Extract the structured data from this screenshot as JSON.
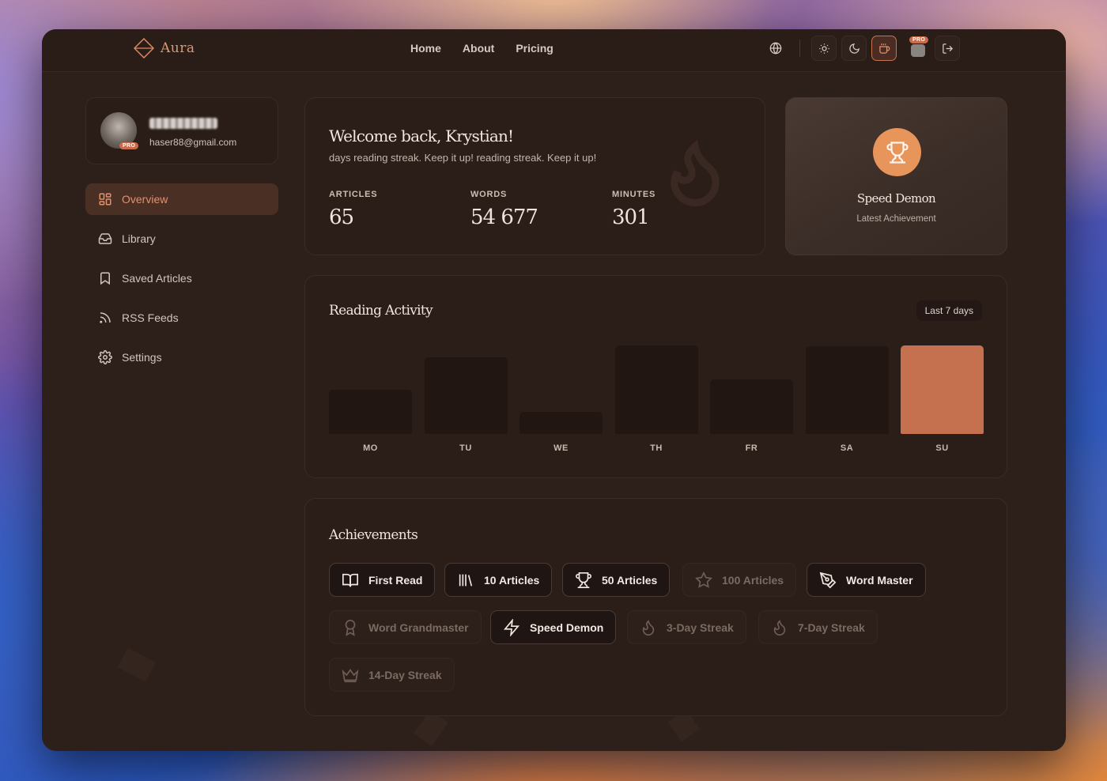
{
  "app": {
    "name": "Aura"
  },
  "nav": {
    "home": "Home",
    "about": "About",
    "pricing": "Pricing"
  },
  "topbar": {
    "pro_badge": "PRO"
  },
  "profile": {
    "email": "haser88@gmail.com",
    "pro_badge": "PRO"
  },
  "sidebar": {
    "items": [
      {
        "label": "Overview",
        "icon": "grid-icon",
        "active": true
      },
      {
        "label": "Library",
        "icon": "inbox-icon"
      },
      {
        "label": "Saved Articles",
        "icon": "bookmark-icon"
      },
      {
        "label": "RSS Feeds",
        "icon": "rss-icon"
      },
      {
        "label": "Settings",
        "icon": "gear-icon"
      }
    ]
  },
  "welcome": {
    "title": "Welcome back, Krystian!",
    "subtitle": "days reading streak. Keep it up! reading streak. Keep it up!",
    "stats": [
      {
        "label": "ARTICLES",
        "value": "65"
      },
      {
        "label": "WORDS",
        "value": "54 677"
      },
      {
        "label": "MINUTES",
        "value": "301"
      }
    ]
  },
  "latest_achievement": {
    "name": "Speed Demon",
    "caption": "Latest Achievement"
  },
  "activity": {
    "title": "Reading Activity",
    "range": "Last 7 days"
  },
  "chart_data": {
    "type": "bar",
    "title": "Reading Activity",
    "categories": [
      "MO",
      "TU",
      "WE",
      "TH",
      "FR",
      "SA",
      "SU"
    ],
    "values": [
      50,
      87,
      25,
      100,
      62,
      99,
      100
    ],
    "highlight_index": 6,
    "ylim": [
      0,
      100
    ],
    "grid": false,
    "colors": {
      "bar": "#221612",
      "highlight": "#c5704f"
    }
  },
  "achievements": {
    "title": "Achievements",
    "items": [
      {
        "label": "First Read",
        "icon": "open-book-icon",
        "unlocked": true
      },
      {
        "label": "10 Articles",
        "icon": "library-icon",
        "unlocked": true
      },
      {
        "label": "50 Articles",
        "icon": "trophy-icon",
        "unlocked": true
      },
      {
        "label": "100 Articles",
        "icon": "star-icon",
        "unlocked": false
      },
      {
        "label": "Word Master",
        "icon": "pen-tool-icon",
        "unlocked": true
      },
      {
        "label": "Word Grandmaster",
        "icon": "award-icon",
        "unlocked": false
      },
      {
        "label": "Speed Demon",
        "icon": "lightning-icon",
        "unlocked": true
      },
      {
        "label": "3-Day Streak",
        "icon": "flame-icon",
        "unlocked": false
      },
      {
        "label": "7-Day Streak",
        "icon": "flame-icon",
        "unlocked": false
      },
      {
        "label": "14-Day Streak",
        "icon": "crown-icon",
        "unlocked": false
      }
    ]
  },
  "colors": {
    "accent": "#e2916d",
    "window_bg": "#2d1f1a",
    "card_bg": "#2b1e19"
  }
}
